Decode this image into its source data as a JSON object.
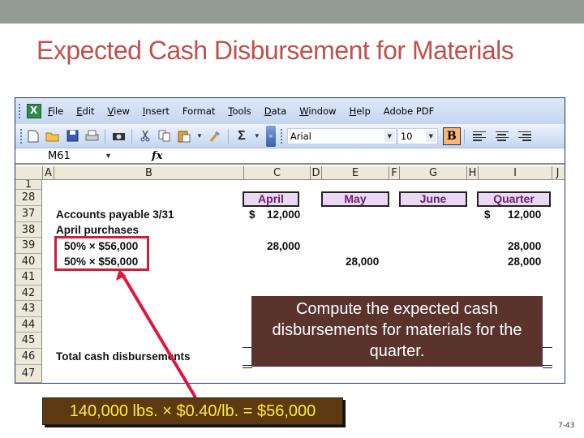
{
  "slide": {
    "title": "Expected Cash Disbursement for Materials",
    "page_number": "7-43"
  },
  "excel": {
    "menu": [
      {
        "label": "File",
        "u": "F",
        "rest": "ile"
      },
      {
        "label": "Edit",
        "u": "E",
        "rest": "dit"
      },
      {
        "label": "View",
        "u": "V",
        "rest": "iew"
      },
      {
        "label": "Insert",
        "u": "I",
        "rest": "nsert"
      },
      {
        "label": "Format",
        "u": "",
        "rest": "Format"
      },
      {
        "label": "Tools",
        "u": "T",
        "rest": "ools"
      },
      {
        "label": "Data",
        "u": "D",
        "rest": "ata"
      },
      {
        "label": "Window",
        "u": "W",
        "rest": "indow"
      },
      {
        "label": "Help",
        "u": "H",
        "rest": "elp"
      },
      {
        "label": "Adobe PDF",
        "u": "",
        "rest": "Adobe PDF"
      }
    ],
    "toolbar": {
      "font_name": "Arial",
      "font_size": "10",
      "bold_label": "B",
      "sigma_label": "Σ",
      "icons": {
        "new": "new-document-icon",
        "open": "open-folder-icon",
        "save": "save-icon",
        "print": "print-icon",
        "camera": "camera-icon",
        "cut": "cut-icon",
        "copy": "copy-icon",
        "paste": "paste-icon",
        "format_painter": "format-painter-icon"
      }
    },
    "formula_bar": {
      "name_box": "M61",
      "fx_label": "fx",
      "formula": ""
    },
    "columns": [
      "A",
      "B",
      "C",
      "D",
      "E",
      "F",
      "G",
      "H",
      "I",
      "J"
    ],
    "rows": [
      "1",
      "28",
      "37",
      "38",
      "39",
      "40",
      "41",
      "42",
      "43",
      "44",
      "45",
      "46",
      "47"
    ],
    "month_headers": [
      "April",
      "May",
      "June",
      "Quarter"
    ],
    "cells": {
      "r37_label": "Accounts payable 3/31",
      "r37_c_dollar": "$",
      "r37_c": "12,000",
      "r37_i_dollar": "$",
      "r37_i": "12,000",
      "r38_label": "April purchases",
      "r39_label": "50% × $56,000",
      "r39_c": "28,000",
      "r39_i": "28,000",
      "r40_label": "50% × $56,000",
      "r40_e": "28,000",
      "r40_i": "28,000",
      "r46_label": "Total cash disbursements"
    }
  },
  "callouts": {
    "instruction": "Compute the expected cash disbursements for materials for the quarter.",
    "calculation": "140,000 lbs. × $0.40/lb. = $56,000"
  },
  "colors": {
    "title": "#c0504d",
    "header_bar": "#929e95",
    "highlight": "#c8213f",
    "instruction_bg": "#5a342c",
    "calculation_bg": "#5e3a10",
    "calculation_text": "#ffeb3b",
    "month_header_bg": "#ead8f4",
    "month_header_text": "#6a1f6a"
  }
}
